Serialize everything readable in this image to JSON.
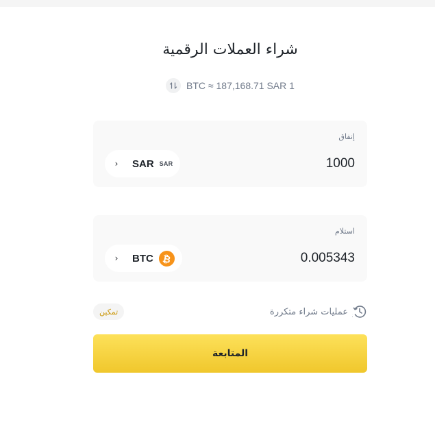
{
  "header": {
    "title": "شراء العملات الرقمية"
  },
  "rate": {
    "text": "BTC ≈ 187,168.71 SAR 1",
    "swap_icon": "swap-arrows-icon"
  },
  "spend": {
    "label": "إنفاق",
    "amount": "1000",
    "currency_code": "SAR",
    "currency_badge": "SAR",
    "chevron_icon": "chevron-icon"
  },
  "receive": {
    "label": "استلام",
    "amount": "0.005343",
    "currency_code": "BTC",
    "currency_icon": "bitcoin-icon",
    "currency_color": "#f7931a",
    "chevron_icon": "chevron-icon"
  },
  "recurring": {
    "label": "عمليات شراء متكررة",
    "icon": "recurring-clock-dollar-icon",
    "enable_label": "تمكين",
    "enable_color": "#c99400"
  },
  "actions": {
    "continue_label": "المتابعة",
    "accent_color": "#fcd535"
  }
}
